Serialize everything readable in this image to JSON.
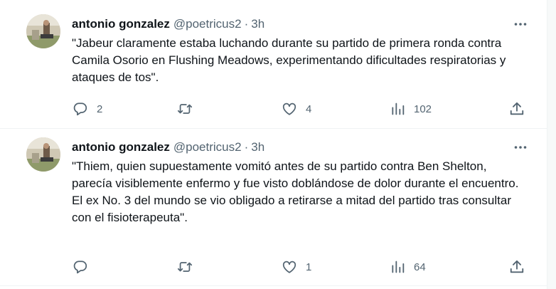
{
  "tweets": [
    {
      "author": {
        "name": "antonio gonzalez",
        "handle": "@poetricus2",
        "separator": "·",
        "time": "3h"
      },
      "text": [
        "\"Jabeur claramente estaba luchando durante su partido de primera ronda contra Camila Osorio en Flushing Meadows, experimentando dificultades respiratorias y ataques de tos\"."
      ],
      "actions": {
        "reply_count": "2",
        "retweet_count": "",
        "like_count": "4",
        "view_count": "102"
      }
    },
    {
      "author": {
        "name": "antonio gonzalez",
        "handle": "@poetricus2",
        "separator": "·",
        "time": "3h"
      },
      "text": [
        "\"Thiem, quien supuestamente vomitó antes de su partido contra Ben Shelton, parecía visiblemente enfermo y fue visto doblándose de dolor durante el encuentro.",
        "El ex No. 3 del mundo se vio obligado a retirarse a mitad del partido tras consultar con el fisioterapeuta\"."
      ],
      "actions": {
        "reply_count": "",
        "retweet_count": "",
        "like_count": "1",
        "view_count": "64"
      }
    }
  ],
  "icons": [
    "more-icon",
    "reply-icon",
    "retweet-icon",
    "like-icon",
    "views-icon",
    "share-icon"
  ],
  "colors": {
    "text": "#0f1419",
    "secondary": "#536471",
    "divider": "#eff3f4"
  }
}
